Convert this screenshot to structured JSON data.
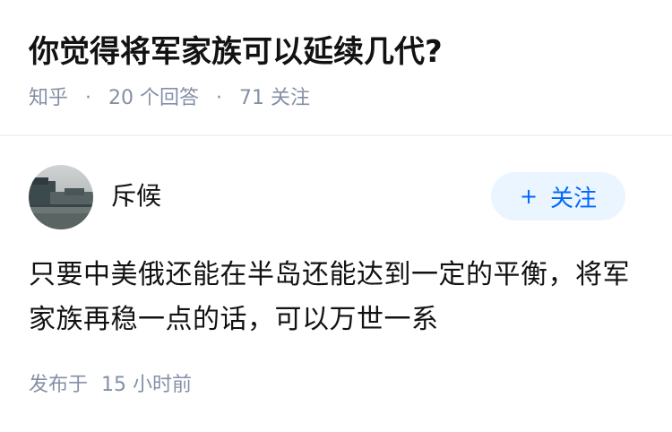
{
  "question": {
    "title": "你觉得将军家族可以延续几代?"
  },
  "meta": {
    "source": "知乎",
    "separator": "·",
    "answers": "20 个回答",
    "follows": "71 关注"
  },
  "author": {
    "name": "斥候",
    "avatar_icon": "avatar-landscape-photo"
  },
  "follow_button": {
    "plus": "+",
    "label": "关注"
  },
  "answer": {
    "text": "只要中美俄还能在半岛还能达到一定的平衡，将军家族再稳一点的话，可以万世一系"
  },
  "posted": {
    "label": "发布于",
    "time": "15 小时前"
  },
  "colors": {
    "title": "#121212",
    "meta": "#8590a6",
    "accent": "#0066ff",
    "follow_bg": "#ebf5ff"
  }
}
